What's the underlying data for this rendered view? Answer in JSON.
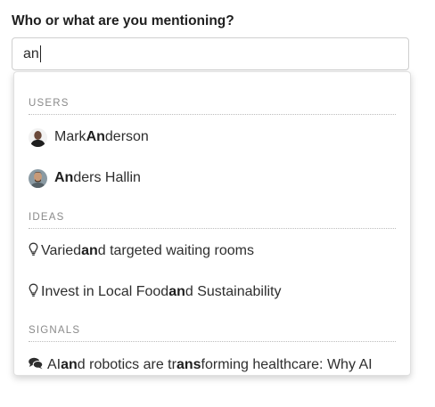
{
  "prompt": {
    "question": "Who or what are you mentioning?"
  },
  "input": {
    "value": "an"
  },
  "dropdown": {
    "sections": [
      {
        "header": "USERS",
        "items": [
          {
            "icon": "user-avatar",
            "parts": [
              "Mark ",
              "An",
              "derson"
            ]
          },
          {
            "icon": "user-avatar",
            "parts": [
              "",
              "An",
              "ders Hallin"
            ]
          }
        ]
      },
      {
        "header": "IDEAS",
        "items": [
          {
            "icon": "lightbulb-icon",
            "parts": [
              "Varied ",
              "an",
              "d targeted waiting rooms"
            ]
          },
          {
            "icon": "lightbulb-icon",
            "parts": [
              "Invest in Local Food ",
              "an",
              "d Sustainability"
            ]
          }
        ]
      },
      {
        "header": "SIGNALS",
        "items": [
          {
            "icon": "chat-bubbles-icon",
            "parts": [
              "AI ",
              "an",
              "d robotics are tr",
              "ans",
              "forming healthcare: Why AI"
            ]
          }
        ]
      }
    ]
  }
}
